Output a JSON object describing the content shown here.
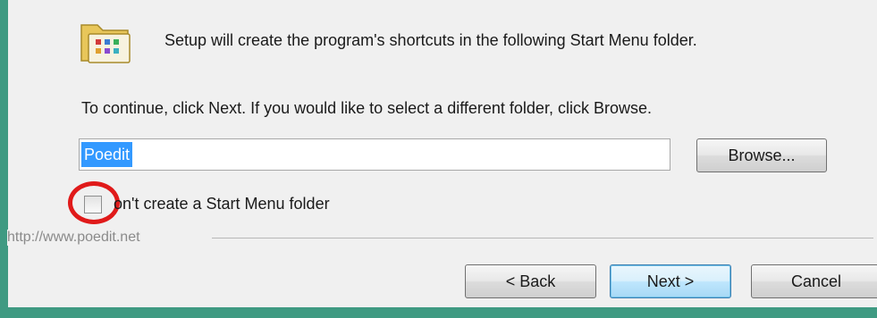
{
  "intro_text": "Setup will create the program's shortcuts in the following Start Menu folder.",
  "instructions": "To continue, click Next. If you would like to select a different folder, click Browse.",
  "folder_field": {
    "value": "Poedit"
  },
  "browse_label": "Browse...",
  "checkbox": {
    "label": "on't create a Start Menu folder",
    "checked": false
  },
  "footer_link": "http://www.poedit.net",
  "buttons": {
    "back": "< Back",
    "next": "Next >",
    "cancel": "Cancel"
  },
  "icons": {
    "folder": "start-menu-folder-icon"
  },
  "colors": {
    "selection": "#3399ff",
    "annotation": "#e01a1a",
    "backdrop": "#3f9a82"
  }
}
